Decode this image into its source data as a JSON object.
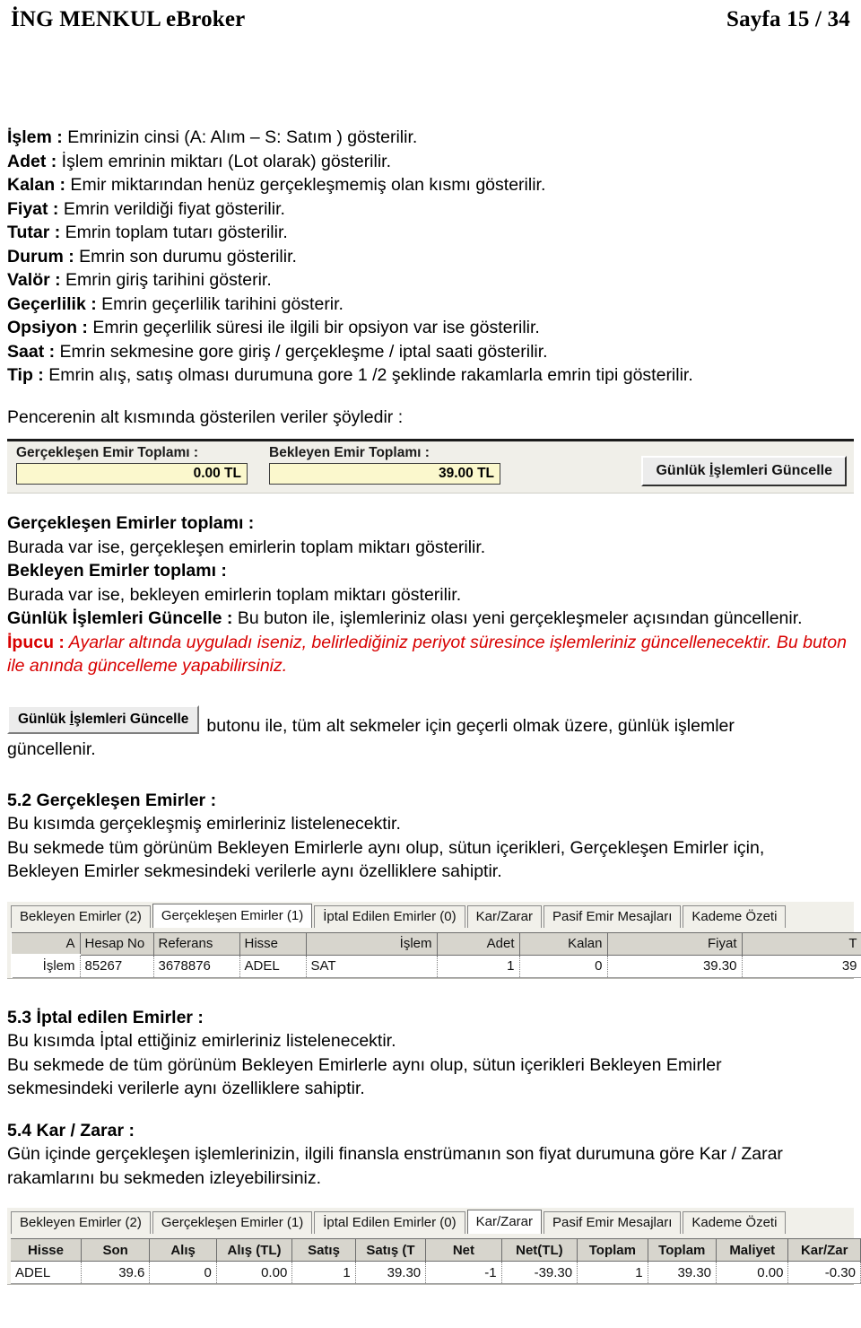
{
  "header": {
    "title": "İNG MENKUL eBroker",
    "page_indicator": "Sayfa 15 / 34"
  },
  "definitions": [
    {
      "term": "İşlem :",
      "desc": " Emrinizin cinsi (A: Alım – S: Satım ) gösterilir."
    },
    {
      "term": "Adet :",
      "desc": " İşlem emrinin miktarı (Lot olarak) gösterilir."
    },
    {
      "term": "Kalan :",
      "desc": " Emir miktarından henüz gerçekleşmemiş olan kısmı gösterilir."
    },
    {
      "term": "Fiyat :",
      "desc": " Emrin verildiği fiyat gösterilir."
    },
    {
      "term": "Tutar :",
      "desc": " Emrin toplam tutarı gösterilir."
    },
    {
      "term": "Durum :",
      "desc": " Emrin son durumu gösterilir."
    },
    {
      "term": "Valör :",
      "desc": " Emrin giriş tarihini gösterir."
    },
    {
      "term": "Geçerlilik :",
      "desc": " Emrin geçerlilik tarihini gösterir."
    },
    {
      "term": "Opsiyon :",
      "desc": " Emrin geçerlilik süresi ile ilgili bir opsiyon var ise gösterilir."
    },
    {
      "term": "Saat :",
      "desc": " Emrin sekmesine gore giriş / gerçekleşme / iptal saati gösterilir."
    },
    {
      "term": "Tip :",
      "desc": " Emrin alış, satış olması durumuna gore 1 /2 şeklinde rakamlarla emrin tipi gösterilir."
    }
  ],
  "intro_bottom": "Pencerenin alt kısmında  gösterilen veriler şöyledir :",
  "totals_panel": {
    "realized_label": "Gerçekleşen Emir Toplamı :",
    "realized_value": "0.00 TL",
    "pending_label": "Bekleyen Emir Toplamı :",
    "pending_value": "39.00 TL",
    "refresh_button_pre": "Günlük ",
    "refresh_button_accel": "İ",
    "refresh_button_post": "şlemleri Güncelle",
    "field_color": "#fbf8cd",
    "panel_color": "#f0efe9"
  },
  "explanations": [
    {
      "term": "Gerçekleşen Emirler toplamı :",
      "desc": "Burada var ise, gerçekleşen emirlerin toplam miktarı gösterilir."
    },
    {
      "term": "Bekleyen Emirler toplamı :",
      "desc": "Burada var ise, bekleyen emirlerin toplam miktarı gösterilir."
    }
  ],
  "gunluk_para": {
    "term": "Günlük İşlemleri Güncelle :",
    "desc": " Bu buton ile, işlemleriniz olası yeni gerçekleşmeler açısından güncellenir."
  },
  "tip": {
    "label": "İpucu :",
    "text": " Ayarlar altında uyguladı iseniz, belirlediğiniz periyot süresince işlemleriniz güncellenecektir. Bu buton ile anında güncelleme yapabilirsiniz.",
    "color": "#d80000"
  },
  "inline_button_para": {
    "button_pre": "Günlük ",
    "button_accel": "İ",
    "button_post": "şlemleri Güncelle",
    "text_after": " butonu ile, tüm alt sekmeler için geçerli olmak üzere, günlük işlemler",
    "text_second_line": "güncellenir."
  },
  "section_52": {
    "heading": "5.2 Gerçekleşen Emirler :",
    "lines": [
      "Bu kısımda gerçekleşmiş emirleriniz listelenecektir.",
      "Bu sekmede tüm görünüm Bekleyen Emirlerle aynı olup, sütun içerikleri, Gerçekleşen Emirler için,",
      "Bekleyen Emirler  sekmesindeki verilerle aynı özelliklere sahiptir."
    ]
  },
  "orders_grid": {
    "tabs": [
      {
        "label": "Bekleyen Emirler (2)",
        "active": false
      },
      {
        "label": "Gerçekleşen Emirler (1)",
        "active": true
      },
      {
        "label": "İptal Edilen Emirler (0)",
        "active": false
      },
      {
        "label": "Kar/Zarar",
        "active": false
      },
      {
        "label": "Pasif Emir Mesajları",
        "active": false
      },
      {
        "label": "Kademe Özeti",
        "active": false
      }
    ],
    "columns": [
      "A",
      "Hesap No",
      "Referans",
      "Hisse",
      "İşlem",
      "Adet",
      "Kalan",
      "Fiyat",
      "T"
    ],
    "row": {
      "action_label": "İşlem",
      "hesap_no": "85267",
      "referans": "3678876",
      "hisse": "ADEL",
      "islem": "SAT",
      "adet": "1",
      "kalan": "0",
      "fiyat": "39.30",
      "tutar_clipped": "39"
    },
    "highlight_color": "#fb0000"
  },
  "section_53": {
    "heading": "5.3 İptal edilen Emirler :",
    "lines": [
      "Bu kısımda İptal ettiğiniz emirleriniz listelenecektir.",
      "Bu sekmede de tüm görünüm Bekleyen Emirlerle aynı olup, sütun içerikleri Bekleyen Emirler",
      "sekmesindeki verilerle aynı özelliklere sahiptir."
    ]
  },
  "section_54": {
    "heading": "5.4 Kar / Zarar :",
    "lines": [
      "Gün içinde gerçekleşen işlemlerinizin, ilgili finansla enstrümanın son fiyat durumuna göre Kar / Zarar",
      "rakamlarını bu sekmeden izleyebilirsiniz."
    ]
  },
  "profit_grid": {
    "tabs": [
      {
        "label": "Bekleyen Emirler (2)",
        "active": false
      },
      {
        "label": "Gerçekleşen Emirler (1)",
        "active": false
      },
      {
        "label": "İptal Edilen Emirler (0)",
        "active": false
      },
      {
        "label": "Kar/Zarar",
        "active": true
      },
      {
        "label": "Pasif Emir Mesajları",
        "active": false
      },
      {
        "label": "Kademe Özeti",
        "active": false
      }
    ],
    "columns": [
      {
        "label": "Hisse",
        "red": false
      },
      {
        "label": "Son",
        "red": false
      },
      {
        "label": "Alış",
        "red": false
      },
      {
        "label": "Alış (TL)",
        "red": false
      },
      {
        "label": "Satış",
        "red": false
      },
      {
        "label": "Satış (T",
        "red": false
      },
      {
        "label": "Net",
        "red": true
      },
      {
        "label": "Net(TL)",
        "red": true
      },
      {
        "label": "Toplam",
        "red": false
      },
      {
        "label": "Toplam",
        "red": false
      },
      {
        "label": "Maliyet",
        "red": false
      },
      {
        "label": "Kar/Zar",
        "red": true
      }
    ],
    "row": {
      "hisse": "ADEL",
      "son": "39.6",
      "alis": "0",
      "alis_tl": "0.00",
      "satis": "1",
      "satis_tl": "39.30",
      "net": "-1",
      "net_tl": "-39.30",
      "toplam_adet": "1",
      "toplam_tl": "39.30",
      "maliyet": "0.00",
      "kar_zarar": "-0.30"
    },
    "negative_color": "#fb0000"
  }
}
